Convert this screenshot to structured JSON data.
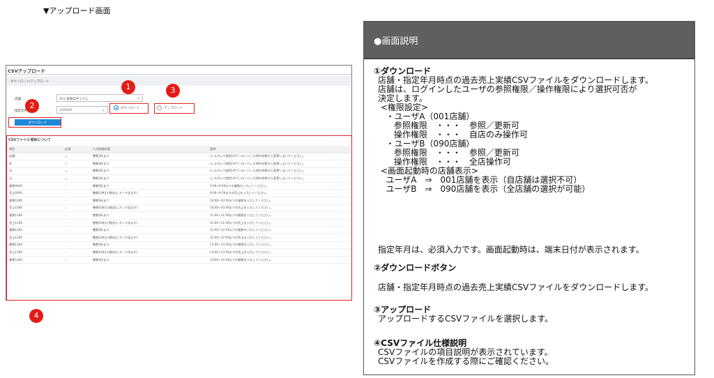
{
  "heading": "▼アップロード画面",
  "screen": {
    "title": "CSVアップロード",
    "section": "ダウンロード/アップロード",
    "store_label": "店舗",
    "store_value": "001:黄霧菜中うさん",
    "month_label": "指定年月",
    "month_value": "2020/05",
    "radio_download": "ダウンロード",
    "radio_upload": "アップロード",
    "download_button": "ダウンロード",
    "spec_title": "CSVファイル項目について",
    "columns": [
      "項目",
      "必須",
      "入力制限内容",
      "説明"
    ],
    "rows": [
      [
        "店舗",
        "○",
        "整数3桁まで",
        "(システムで使用)ダウンロードした時の状態から変更しないでください。"
      ],
      [
        "年",
        "○",
        "整数4桁まで",
        "(システムで使用)ダウンロードした時の状態から変更しないでください。"
      ],
      [
        "月",
        "○",
        "整数2桁まで",
        "(システムで使用)ダウンロードした時の状態から変更しないでください。"
      ],
      [
        "日",
        "○",
        "整数2桁まで",
        "(システムで使用)ダウンロードした時の状態から変更しないでください。"
      ],
      [
        "客数0900",
        "-",
        "整数5桁まで",
        "9:00~9:59までの客数を入力してください。"
      ],
      [
        "売上0900",
        "-",
        "整数10桁(小数含む,カンマ含まず)",
        "9:00~9:59までの売上を入力してください。"
      ],
      [
        "客数1000",
        "-",
        "整数5桁まで",
        "10:00~10:59までの客数を入力してください。"
      ],
      [
        "売上1000",
        "-",
        "整数10桁(小数含む,カンマ含まず)",
        "10:00~10:59までの売上を入力してください。"
      ],
      [
        "客数1100",
        "-",
        "整数5桁まで",
        "11:00~11:59までの客数を入力してください。"
      ],
      [
        "売上1100",
        "-",
        "整数10桁(小数含む,カンマ含まず)",
        "11:00~11:59までの売上を入力してください。"
      ],
      [
        "客数1200",
        "-",
        "整数5桁まで",
        "12:00~12:59までの客数を入力してください。"
      ],
      [
        "売上1200",
        "-",
        "整数10桁(小数含む,カンマ含まず)",
        "12:00~12:59までの売上を入力してください。"
      ],
      [
        "客数1300",
        "-",
        "整数5桁まで",
        "13:00~13:59までの客数を入力してください。"
      ],
      [
        "売上1300",
        "-",
        "整数10桁(小数含む,カンマ含まず)",
        "13:00~13:59までの売上を入力してください。"
      ],
      [
        "客数1400",
        "-",
        "整数5桁まで",
        "14:00~14:59までの客数を入力してください。"
      ]
    ]
  },
  "markers": {
    "m1": "1",
    "m2": "2",
    "m3": "3",
    "m4": "4"
  },
  "colors": {
    "marker_red": "#e41c18",
    "button_blue": "#1e88d8",
    "header_gray": "#5f5f5f"
  },
  "description": {
    "header": "●画面説明",
    "s1_title": "①ダウンロード",
    "s1_body": "店舗・指定年月時点の過去売上実績CSVファイルをダウンロードします。\n店舗は、ログインしたユーザの参照権限／操作権限により選択可否が\n決定します。\n <権限設定>\n   ・ユーザA（001店舗）\n      参照権限　・・・　参照／更新可\n      操作権限　・・・　自店のみ操作可\n   ・ユーザB（090店舗）\n      参照権限　・・・　参照／更新可\n      操作権限　・・・　全店操作可\n <画面起動時の店舗表示>\n   ユーザA　⇒　001店舗を表示（自店舗は選択不可）\n   ユーザB　⇒　090店舗を表示（全店舗の選択が可能）",
    "s1_note": "指定年月は、必須入力です。画面起動時は、端末日付が表示されます。",
    "s2_title": "②ダウンロードボタン",
    "s2_body": "店舗・指定年月時点の過去売上実績CSVファイルをダウンロードします。",
    "s3_title": "③アップロード",
    "s3_body": "アップロードするCSVファイルを選択します。",
    "s4_title": "④CSVファイル仕様説明",
    "s4_body": "CSVファイルの項目説明が表示されています。\nCSVファイルを作成する際にご確認ください。"
  }
}
